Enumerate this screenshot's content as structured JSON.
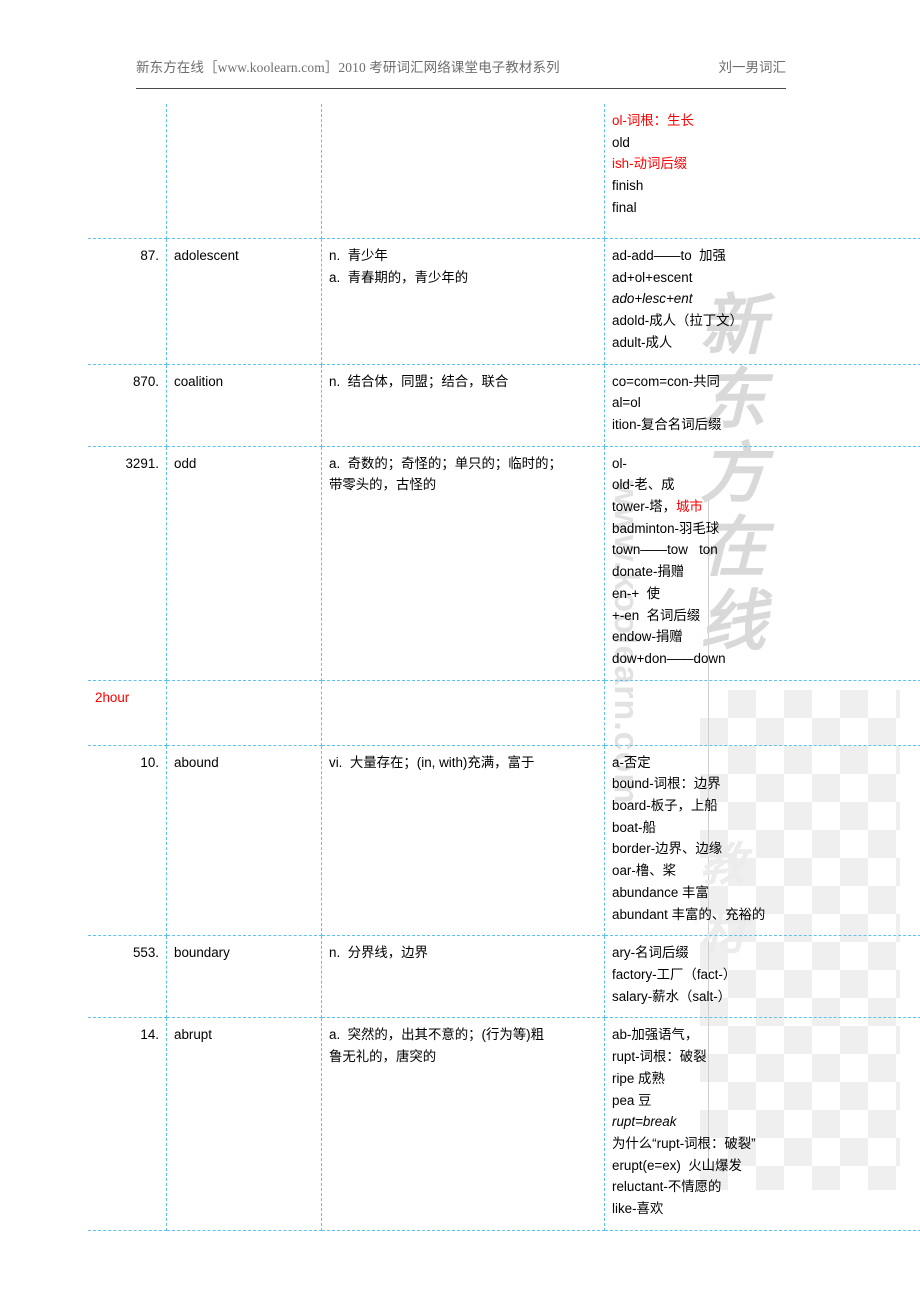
{
  "header": {
    "left": "新东方在线［www.koolearn.com］2010 考研词汇网络课堂电子教材系列",
    "right": "刘一男词汇"
  },
  "watermark": {
    "brand": "新\n东\n方\n在\n线",
    "url": "www.koolearn.com",
    "sub": "教\n材"
  },
  "table": {
    "rows": [
      {
        "num": "",
        "word": "",
        "definition": "",
        "roots": [
          {
            "text": "ol-词根：生长",
            "color": "red"
          },
          {
            "text": "old",
            "color": "black"
          },
          {
            "text": "ish-动词后缀",
            "color": "red"
          },
          {
            "text": "finish",
            "color": "black"
          },
          {
            "text": "final",
            "color": "black"
          }
        ]
      },
      {
        "num": "87.",
        "word": "adolescent",
        "definition_lines": [
          "n.  青少年",
          "a.  青春期的，青少年的"
        ],
        "roots": [
          {
            "text": "ad-add——to  加强",
            "color": "black"
          },
          {
            "text": "ad+ol+escent",
            "color": "black"
          },
          {
            "text": "ado+lesc+ent",
            "color": "black",
            "italic": true
          },
          {
            "text": "adold-成人（拉丁文）",
            "color": "black"
          },
          {
            "text": "adult-成人",
            "color": "black"
          }
        ]
      },
      {
        "num": "870.",
        "word": "coalition",
        "definition_lines": [
          "n.  结合体，同盟；结合，联合"
        ],
        "roots": [
          {
            "text": "co=com=con-共同",
            "color": "black"
          },
          {
            "text": "al=ol",
            "color": "black"
          },
          {
            "text": "ition-复合名词后缀",
            "color": "black"
          }
        ]
      },
      {
        "num": "3291.",
        "word": "odd",
        "definition_lines": [
          "a.  奇数的；奇怪的；单只的；临时的；",
          "带零头的，古怪的"
        ],
        "roots": [
          {
            "text": "ol-",
            "color": "black"
          },
          {
            "text": "old-老、成",
            "color": "black"
          },
          {
            "text": "tower-塔，",
            "color": "black",
            "suffix_red": "城市"
          },
          {
            "text": "badminton-羽毛球",
            "color": "black"
          },
          {
            "text": "town——tow   ton",
            "color": "black"
          },
          {
            "text": "donate-捐赠",
            "color": "black"
          },
          {
            "text": "en-+  使",
            "color": "black"
          },
          {
            "text": "+-en  名词后缀",
            "color": "black"
          },
          {
            "text": "endow-捐赠",
            "color": "black"
          },
          {
            "text": "dow+don——down",
            "color": "black"
          }
        ]
      },
      {
        "num": "2hour",
        "num_color": "red",
        "word": "",
        "definition": "",
        "roots": []
      },
      {
        "num": "10.",
        "word": "abound",
        "definition_lines": [
          "vi.  大量存在；(in, with)充满，富于"
        ],
        "roots": [
          {
            "text": "a-否定",
            "color": "black"
          },
          {
            "text": "bound-词根：边界",
            "color": "black"
          },
          {
            "text": "board-板子，上船",
            "color": "black"
          },
          {
            "text": "boat-船",
            "color": "black"
          },
          {
            "text": "border-边界、边缘",
            "color": "black"
          },
          {
            "text": "oar-橹、桨",
            "color": "black"
          },
          {
            "text": "abundance 丰富",
            "color": "black"
          },
          {
            "text": "abundant 丰富的、充裕的",
            "color": "black"
          }
        ]
      },
      {
        "num": "553.",
        "word": "boundary",
        "definition_lines": [
          "n.  分界线，边界"
        ],
        "roots": [
          {
            "text": "ary-名词后缀",
            "color": "black"
          },
          {
            "text": "factory-工厂（fact-）",
            "color": "black"
          },
          {
            "text": "salary-薪水（salt-）",
            "color": "black"
          }
        ]
      },
      {
        "num": "14.",
        "word": "abrupt",
        "definition_lines": [
          "a.  突然的，出其不意的；(行为等)粗",
          "鲁无礼的，唐突的"
        ],
        "roots": [
          {
            "text": "ab-加强语气，",
            "color": "black"
          },
          {
            "text": "rupt-词根：破裂",
            "color": "black"
          },
          {
            "text": "ripe 成熟",
            "color": "black"
          },
          {
            "text": "pea 豆",
            "color": "black"
          },
          {
            "text": "rupt=break",
            "color": "black",
            "italic": true
          },
          {
            "text": "为什么“rupt-词根：破裂”",
            "color": "black"
          },
          {
            "text": "erupt(e=ex)  火山爆发",
            "color": "black"
          },
          {
            "text": "reluctant-不情愿的",
            "color": "black"
          },
          {
            "text": "like-喜欢",
            "color": "black"
          }
        ]
      }
    ]
  }
}
